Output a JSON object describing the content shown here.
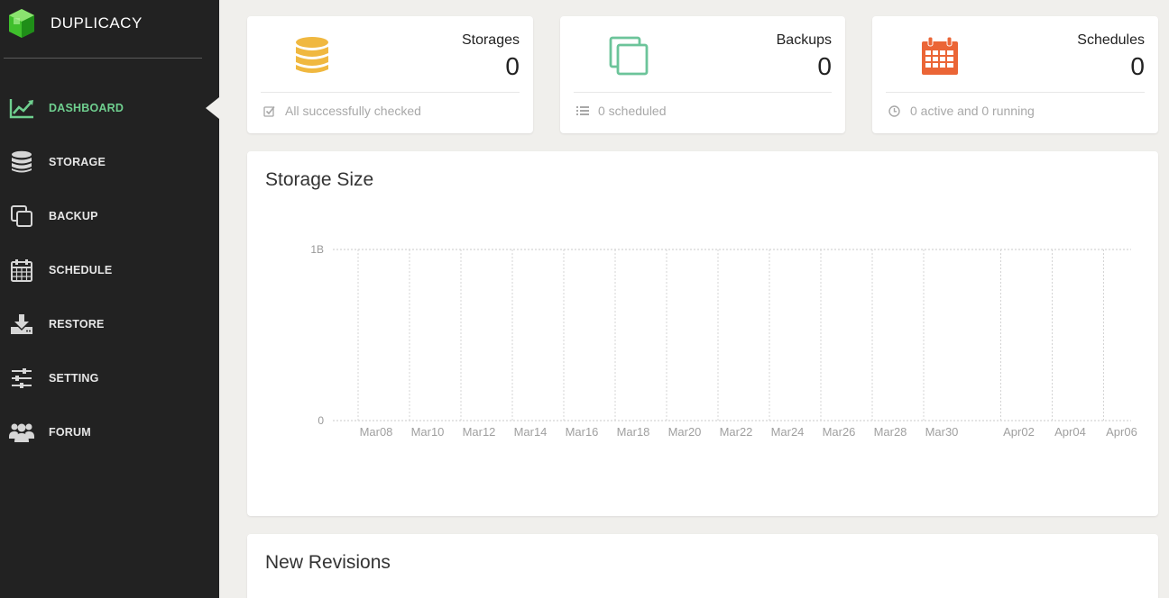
{
  "app": {
    "brand": "DUPLICACY"
  },
  "sidebar": {
    "items": [
      {
        "label": "DASHBOARD",
        "icon": "line-chart-icon",
        "active": true
      },
      {
        "label": "STORAGE",
        "icon": "database-icon",
        "active": false
      },
      {
        "label": "BACKUP",
        "icon": "copy-icon",
        "active": false
      },
      {
        "label": "SCHEDULE",
        "icon": "calendar-icon",
        "active": false
      },
      {
        "label": "RESTORE",
        "icon": "download-icon",
        "active": false
      },
      {
        "label": "SETTING",
        "icon": "sliders-icon",
        "active": false
      },
      {
        "label": "FORUM",
        "icon": "users-icon",
        "active": false
      }
    ]
  },
  "stats": {
    "storages": {
      "title": "Storages",
      "value": "0",
      "footer": "All successfully checked",
      "icon": "database-icon",
      "color": "#f0b840"
    },
    "backups": {
      "title": "Backups",
      "value": "0",
      "footer": "0 scheduled",
      "icon": "copy-icon",
      "color": "#6cc49a"
    },
    "schedules": {
      "title": "Schedules",
      "value": "0",
      "footer": "0 active and 0 running",
      "icon": "calendar-icon",
      "color": "#eb6536"
    }
  },
  "storage_panel": {
    "title": "Storage Size"
  },
  "revisions_panel": {
    "title": "New Revisions"
  },
  "chart_data": {
    "type": "line",
    "title": "Storage Size",
    "x": [
      "Mar08",
      "Mar10",
      "Mar12",
      "Mar14",
      "Mar16",
      "Mar18",
      "Mar20",
      "Mar22",
      "Mar24",
      "Mar26",
      "Mar28",
      "Mar30",
      "Apr02",
      "Apr04",
      "Apr06"
    ],
    "y_ticks": [
      "0",
      "1B"
    ],
    "ylim": [
      0,
      1
    ],
    "series": [],
    "grid": true
  },
  "colors": {
    "sidebar_bg": "#222222",
    "accent": "#6fcf8f",
    "page_bg": "#f0efec"
  }
}
